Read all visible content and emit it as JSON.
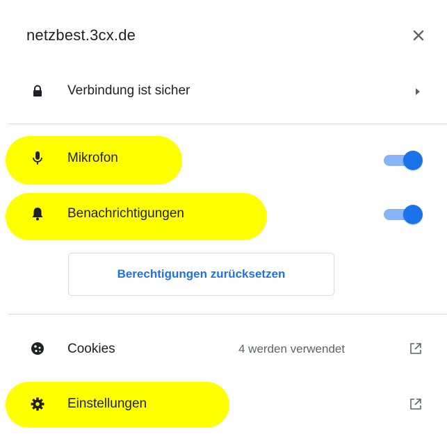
{
  "header": {
    "site": "netzbest.3cx.de",
    "close_icon": "close-icon"
  },
  "connection": {
    "label": "Verbindung ist sicher",
    "icon": "lock-icon"
  },
  "permissions": [
    {
      "label": "Mikrofon",
      "icon": "microphone-icon",
      "enabled": true
    },
    {
      "label": "Benachrichtigungen",
      "icon": "bell-icon",
      "enabled": true
    }
  ],
  "reset_button": {
    "label": "Berechtigungen zurücksetzen"
  },
  "cookies": {
    "label": "Cookies",
    "status": "4 werden verwendet",
    "icon": "cookie-icon"
  },
  "settings": {
    "label": "Einstellungen",
    "icon": "gear-icon"
  },
  "colors": {
    "accent": "#1a73e8",
    "toggle_track": "#8ab4f8",
    "highlight": "#ffff00",
    "text": "#202124",
    "muted": "#5f6368",
    "divider": "#dadce0"
  }
}
